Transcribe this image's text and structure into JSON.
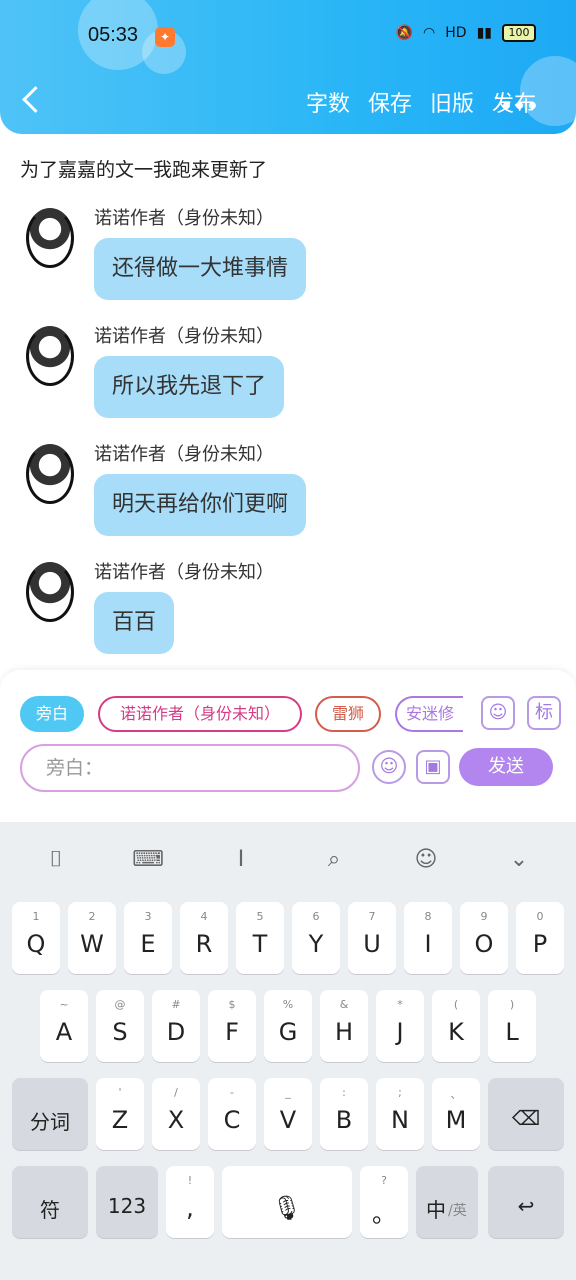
{
  "status": {
    "time": "05:33",
    "battery": "100"
  },
  "header": {
    "actions": [
      "字数",
      "保存",
      "旧版",
      "发布"
    ]
  },
  "content": {
    "intro": "为了嘉嘉的文一我跑来更新了",
    "messages": [
      {
        "sender": "诺诺作者（身份未知）",
        "text": "还得做一大堆事情"
      },
      {
        "sender": "诺诺作者（身份未知）",
        "text": "所以我先退下了"
      },
      {
        "sender": "诺诺作者（身份未知）",
        "text": "明天再给你们更啊"
      },
      {
        "sender": "诺诺作者（身份未知）",
        "text": "百百"
      }
    ]
  },
  "composer": {
    "chips": [
      "旁白",
      "诺诺作者（身份未知）",
      "雷狮",
      "安迷修"
    ],
    "icons": [
      "person-icon",
      "label-icon",
      "smile-icon",
      "image-icon"
    ],
    "input_placeholder": "旁白：",
    "send_label": "发送"
  },
  "keyboard": {
    "row1": [
      {
        "main": "Q",
        "sub": "1"
      },
      {
        "main": "W",
        "sub": "2"
      },
      {
        "main": "E",
        "sub": "3"
      },
      {
        "main": "R",
        "sub": "4"
      },
      {
        "main": "T",
        "sub": "5"
      },
      {
        "main": "Y",
        "sub": "6"
      },
      {
        "main": "U",
        "sub": "7"
      },
      {
        "main": "I",
        "sub": "8"
      },
      {
        "main": "O",
        "sub": "9"
      },
      {
        "main": "P",
        "sub": "0"
      }
    ],
    "row2": [
      {
        "main": "A",
        "sub": "~"
      },
      {
        "main": "S",
        "sub": "@"
      },
      {
        "main": "D",
        "sub": "#"
      },
      {
        "main": "F",
        "sub": "$"
      },
      {
        "main": "G",
        "sub": "%"
      },
      {
        "main": "H",
        "sub": "&"
      },
      {
        "main": "J",
        "sub": "*"
      },
      {
        "main": "K",
        "sub": "("
      },
      {
        "main": "L",
        "sub": ")"
      }
    ],
    "row3_left": "分词",
    "row3": [
      {
        "main": "Z",
        "sub": "'"
      },
      {
        "main": "X",
        "sub": "/"
      },
      {
        "main": "C",
        "sub": "-"
      },
      {
        "main": "V",
        "sub": "_"
      },
      {
        "main": "B",
        "sub": ":"
      },
      {
        "main": "N",
        "sub": ";"
      },
      {
        "main": "M",
        "sub": "、"
      }
    ],
    "row4": {
      "symbol": "符",
      "num": "123",
      "punct_main": ",",
      "punct_sub": "!",
      "dot_main": "。",
      "dot_sub": "?",
      "lang_main": "中",
      "lang_sub": "/英"
    }
  }
}
